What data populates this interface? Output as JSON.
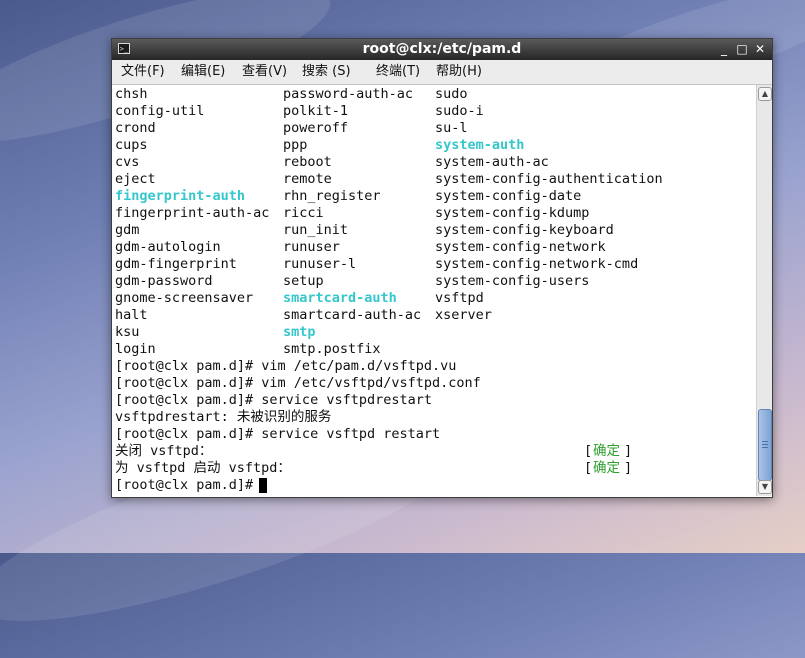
{
  "window": {
    "title": "root@clx:/etc/pam.d",
    "minimize_label": "_",
    "maximize_label": "□",
    "close_label": "✕",
    "icon": "terminal-icon"
  },
  "menu": [
    "文件(F)",
    "编辑(E)",
    "查看(V)",
    "搜索 (S)",
    "终端(T)",
    "帮助(H)"
  ],
  "listing": {
    "col1": [
      "chsh",
      "config-util",
      "crond",
      "cups",
      "cvs",
      "eject",
      "fingerprint-auth",
      "fingerprint-auth-ac",
      "gdm",
      "gdm-autologin",
      "gdm-fingerprint",
      "gdm-password",
      "gnome-screensaver",
      "halt",
      "ksu",
      "login"
    ],
    "col2": [
      "password-auth-ac",
      "polkit-1",
      "poweroff",
      "ppp",
      "reboot",
      "remote",
      "rhn_register",
      "ricci",
      "run_init",
      "runuser",
      "runuser-l",
      "setup",
      "smartcard-auth",
      "smartcard-auth-ac",
      "smtp",
      "smtp.postfix"
    ],
    "col3": [
      "sudo",
      "sudo-i",
      "su-l",
      "system-auth",
      "system-auth-ac",
      "system-config-authentication",
      "system-config-date",
      "system-config-kdump",
      "system-config-keyboard",
      "system-config-network",
      "system-config-network-cmd",
      "system-config-users",
      "vsftpd",
      "xserver"
    ]
  },
  "session": [
    "[root@clx pam.d]# vim /etc/pam.d/vsftpd.vu",
    "[root@clx pam.d]# vim /etc/vsftpd/vsftpd.conf",
    "[root@clx pam.d]# service vsftpdrestart",
    "vsftpdrestart: 未被识别的服务",
    "[root@clx pam.d]# service vsftpd restart",
    "关闭 vsftpd：",
    "为 vsftpd 启动 vsftpd：",
    "[root@clx pam.d]# "
  ],
  "status": {
    "bracket_open": "[",
    "bracket_close": "]",
    "ok_text": "确定"
  },
  "colors": {
    "highlight": "#35c7cc",
    "ok": "#2e9e2e",
    "text": "#111111",
    "background": "#ffffff"
  }
}
